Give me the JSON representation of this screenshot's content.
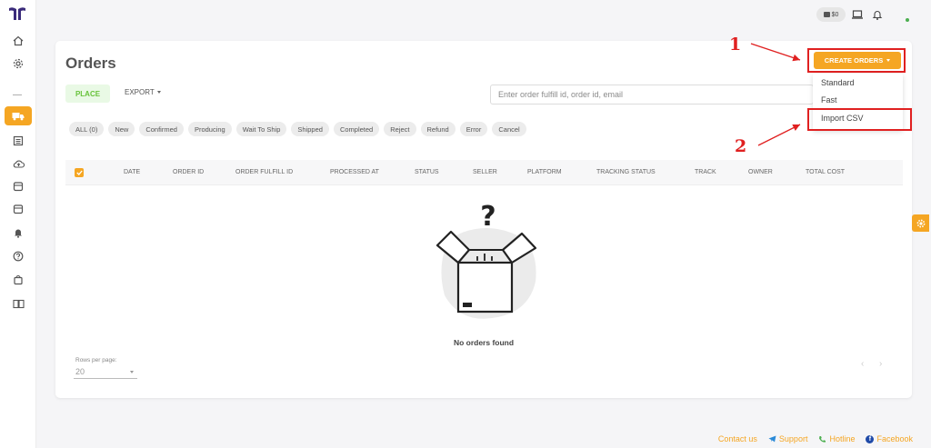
{
  "sidebar": {
    "logo": "brand-logo",
    "items": [
      {
        "name": "home-icon"
      },
      {
        "name": "settings-icon"
      },
      {
        "name": "orders-truck-icon",
        "active": true
      },
      {
        "name": "list-icon"
      },
      {
        "name": "cloud-upload-icon"
      },
      {
        "name": "box-icon"
      },
      {
        "name": "archive-icon"
      },
      {
        "name": "bell-icon"
      },
      {
        "name": "help-icon"
      },
      {
        "name": "shopping-bag-icon"
      },
      {
        "name": "book-icon"
      }
    ],
    "separator": "—"
  },
  "topbar": {
    "wallet_balance": "$0",
    "accent": "#f5a623"
  },
  "page": {
    "title": "Orders",
    "tab_place": "PLACE",
    "export_label": "EXPORT",
    "search_placeholder": "Enter order fulfill id, order id, email"
  },
  "status_chips": [
    "ALL (0)",
    "New",
    "Confirmed",
    "Producing",
    "Wait To Ship",
    "Shipped",
    "Completed",
    "Reject",
    "Refund",
    "Error",
    "Cancel"
  ],
  "table": {
    "columns": [
      "DATE",
      "ORDER ID",
      "ORDER FULFILL ID",
      "PROCESSED AT",
      "STATUS",
      "SELLER",
      "PLATFORM",
      "TRACKING STATUS",
      "TRACK",
      "OWNER",
      "TOTAL COST"
    ],
    "empty_message": "No orders found"
  },
  "pagination": {
    "rows_label": "Rows per page:",
    "rows_value": "20",
    "prev": "‹",
    "next": "›"
  },
  "create_orders": {
    "label": "CREATE ORDERS",
    "options": [
      "Standard",
      "Fast",
      "Import CSV"
    ]
  },
  "annotations": {
    "step1": "1",
    "step2": "2",
    "color": "#e02020"
  },
  "footer": {
    "contact": "Contact us",
    "support": "Support",
    "hotline": "Hotline",
    "facebook": "Facebook"
  }
}
